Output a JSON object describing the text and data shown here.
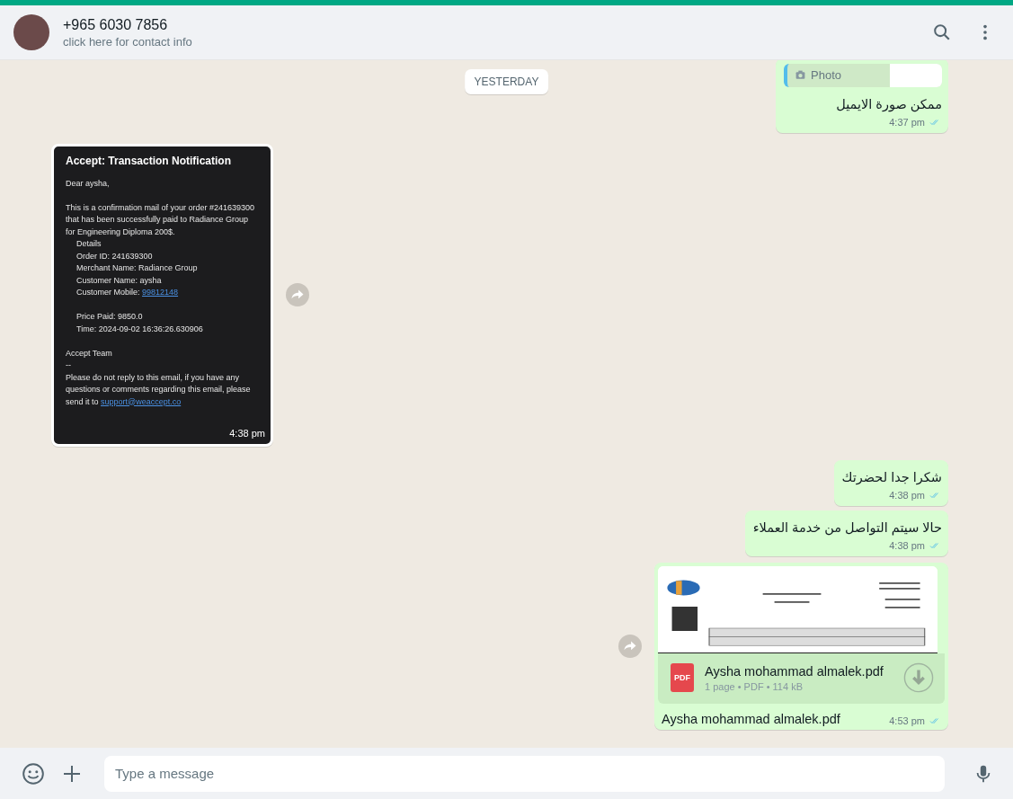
{
  "header": {
    "contact_name": "+965 6030 7856",
    "subtitle": "click here for contact info"
  },
  "date_label": "YESTERDAY",
  "messages": [
    {
      "kind": "text",
      "outgoing": true,
      "quote": {
        "label": "Photo"
      },
      "text": "ممكن صورة الايميل",
      "time": "4:37 pm",
      "read": true
    },
    {
      "kind": "email_image",
      "outgoing": false,
      "time": "4:38 pm",
      "email": {
        "title": "Accept: Transaction Notification",
        "lines": [
          {
            "text": "Dear aysha,",
            "indent": false,
            "gap_before": false
          },
          {
            "text": "This is a confirmation mail of your order #241639300 that has been successfully paid to Radiance Group for Engineering Diploma 200$.",
            "indent": false,
            "gap_before": true
          },
          {
            "text": "Details",
            "indent": true,
            "gap_before": false
          },
          {
            "text": "Order ID: 241639300",
            "indent": true,
            "gap_before": false
          },
          {
            "text": "Merchant Name: Radiance Group",
            "indent": true,
            "gap_before": false
          },
          {
            "text": "Customer Name: aysha",
            "indent": true,
            "gap_before": false
          },
          {
            "text": "Customer Mobile: ",
            "link": "99812148",
            "indent": true,
            "gap_before": false
          },
          {
            "text": "Price Paid: 9850.0",
            "indent": true,
            "gap_before": true
          },
          {
            "text": "Time: 2024-09-02 16:36:26.630906",
            "indent": true,
            "gap_before": false
          },
          {
            "text": "Accept Team",
            "indent": false,
            "gap_before": true
          },
          {
            "text": "--",
            "indent": false,
            "gap_before": false
          },
          {
            "text": "Please do not reply to this email, if you have any questions or comments regarding this email, please send it to ",
            "link": "support@weaccept.co",
            "indent": false,
            "gap_before": false
          }
        ]
      }
    },
    {
      "kind": "text",
      "outgoing": true,
      "text": "شكرا جدا لحضرتك",
      "time": "4:38 pm",
      "read": true
    },
    {
      "kind": "text",
      "outgoing": true,
      "text": "حالا سيتم التواصل من خدمة العملاء",
      "time": "4:38 pm",
      "read": true
    },
    {
      "kind": "document",
      "outgoing": true,
      "file_name": "Aysha mohammad almalek.pdf",
      "file_type": "PDF",
      "file_meta": "1 page • PDF • 114 kB",
      "caption": "Aysha mohammad almalek.pdf",
      "time": "4:53 pm",
      "read": true
    }
  ],
  "composer": {
    "placeholder": "Type a message"
  }
}
